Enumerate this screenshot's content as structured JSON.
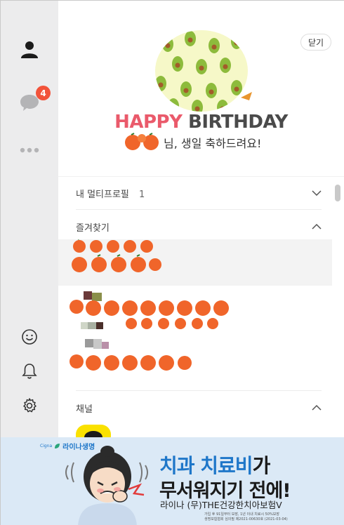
{
  "window": {
    "controls": {
      "minimize": "–",
      "maximize": "☐",
      "close": "✕"
    }
  },
  "sidebar": {
    "items": [
      {
        "icon": "person-icon"
      },
      {
        "icon": "chat-bubble-icon",
        "badge": "4"
      },
      {
        "icon": "more-dots-icon"
      }
    ],
    "bottom": [
      {
        "icon": "emoji-face-icon"
      },
      {
        "icon": "bell-icon"
      },
      {
        "icon": "gear-icon"
      }
    ]
  },
  "banner": {
    "close_label": "닫기",
    "title_word1": "HAPPY",
    "title_word2": "BIRTHDAY",
    "subtitle": "님, 생일 축하드려요!"
  },
  "sections": {
    "multi_profile": {
      "label": "내 멀티프로필",
      "count": "1"
    },
    "favorites": {
      "label": "즐겨찾기"
    },
    "channel": {
      "label": "채널"
    }
  },
  "ad": {
    "brand": "라이나생명",
    "brand_small": "Cigna",
    "headline1_blue_a": "치과",
    "headline1_blue_b": "치료비",
    "headline1_dark": "가",
    "headline2": "무서워지기 전에!",
    "headline3": "라이나 (무)THE건강한치아보험V",
    "fine1": "가입 후 91일부터 보장, 1년 이내 치료시 50%보장",
    "fine2": "생명보험협회 심의필 제2021-00630호 (2021-03-04)"
  },
  "colors": {
    "accent_red": "#ea5a6b",
    "badge_red": "#f2533a",
    "ad_blue": "#1f77c9",
    "sidebar_bg": "#ececed"
  }
}
